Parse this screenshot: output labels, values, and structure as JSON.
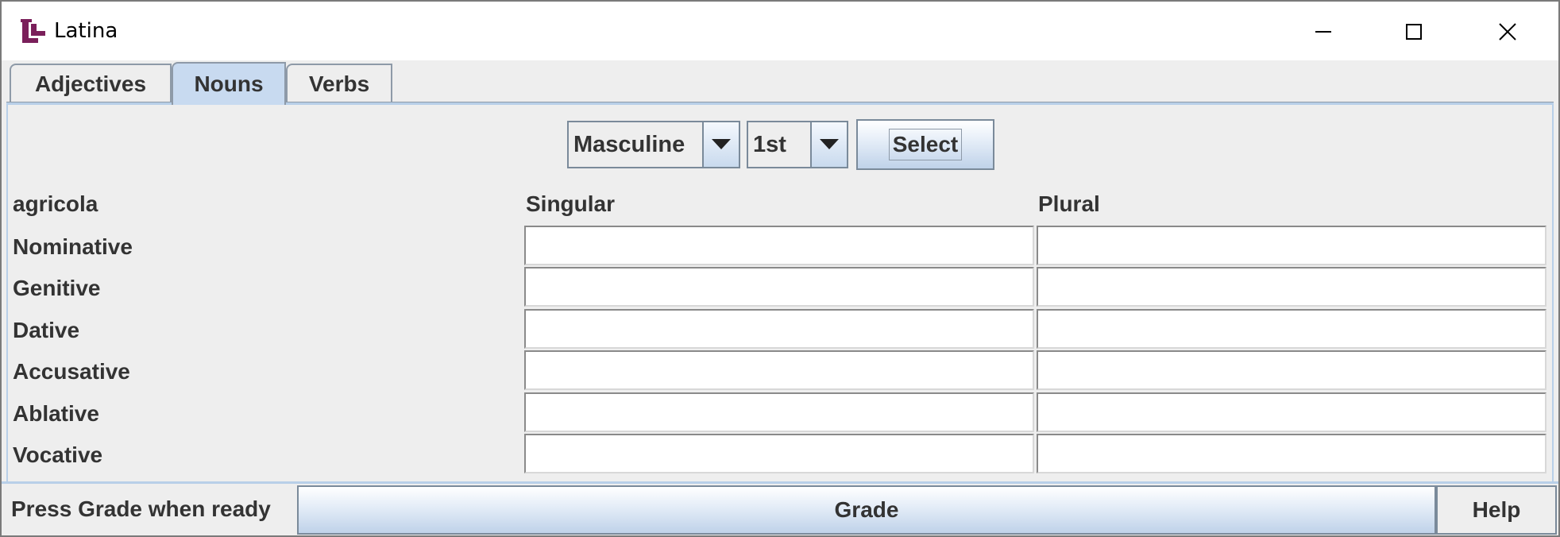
{
  "window": {
    "title": "Latina",
    "icon": "latina-logo-icon",
    "controls": [
      "minimize-icon",
      "maximize-icon",
      "close-icon"
    ]
  },
  "tabs": [
    {
      "label": "Adjectives",
      "active": false
    },
    {
      "label": "Nouns",
      "active": true
    },
    {
      "label": "Verbs",
      "active": false
    }
  ],
  "toolbar": {
    "gender_value": "Masculine",
    "declension_value": "1st",
    "select_label": "Select"
  },
  "table": {
    "word": "agricola",
    "columns": [
      "Singular",
      "Plural"
    ],
    "rows": [
      "Nominative",
      "Genitive",
      "Dative",
      "Accusative",
      "Ablative",
      "Vocative"
    ]
  },
  "footer": {
    "status": "Press Grade when ready",
    "grade_label": "Grade",
    "help_label": "Help"
  },
  "colors": {
    "active_tab": "#c8daf0",
    "accent_border": "#b8cfe8",
    "logo": "#7a1f5a"
  }
}
